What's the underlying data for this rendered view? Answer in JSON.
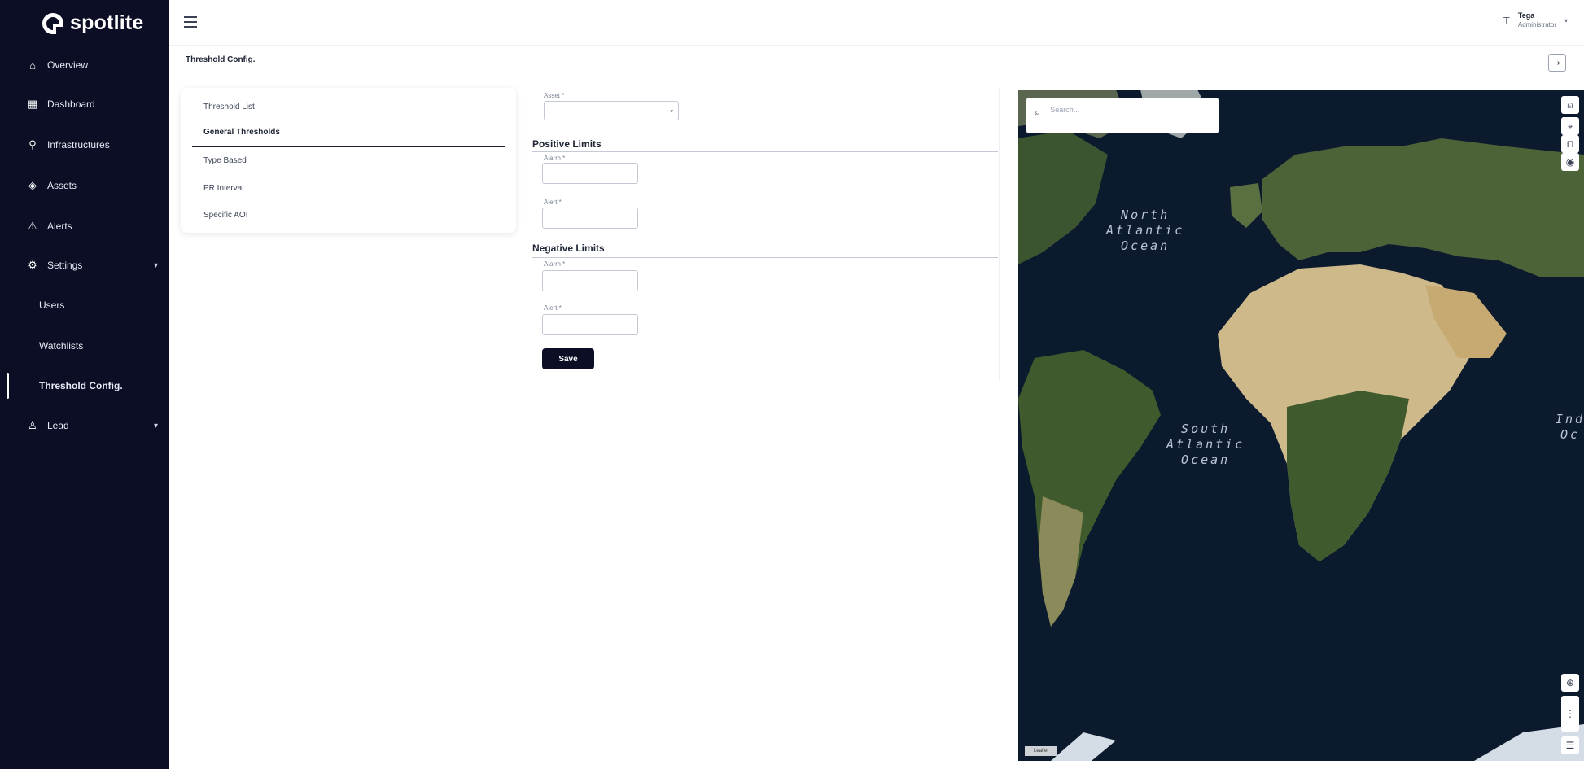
{
  "brand": {
    "name": "spotlite"
  },
  "sidebar": {
    "items": [
      {
        "label": "Overview",
        "icon": "home-icon"
      },
      {
        "label": "Dashboard",
        "icon": "grid-icon"
      },
      {
        "label": "Infrastructures",
        "icon": "network-icon"
      },
      {
        "label": "Assets",
        "icon": "shield-icon"
      },
      {
        "label": "Alerts",
        "icon": "warning-icon"
      },
      {
        "label": "Settings",
        "icon": "gear-icon"
      },
      {
        "label": "Users"
      },
      {
        "label": "Watchlists"
      },
      {
        "label": "Threshold Config."
      },
      {
        "label": "Lead",
        "icon": "user-icon"
      }
    ],
    "active": "Threshold Config."
  },
  "header": {
    "user_initial": "T",
    "user_name": "Tega",
    "user_role": "Administrator"
  },
  "page": {
    "title": "Threshold Config."
  },
  "threshold_nav": {
    "items": [
      "Threshold List",
      "General Thresholds",
      "Type Based",
      "PR Interval",
      "Specific AOI"
    ],
    "active": "General Thresholds"
  },
  "form": {
    "asset_label": "Asset *",
    "positive_title": "Positive Limits",
    "negative_title": "Negative Limits",
    "alarm_label": "Alarm *",
    "alert_label": "Alert *",
    "save_label": "Save"
  },
  "map": {
    "search_placeholder": "Search...",
    "ocean_north": [
      "North",
      "Atlantic",
      "Ocean"
    ],
    "ocean_south": [
      "South",
      "Atlantic",
      "Ocean"
    ],
    "ocean_indian": [
      "Ind",
      "Oc"
    ],
    "attribution": "Leaflet",
    "colors": {
      "ocean": "#0c1a2e",
      "land_green": "#3f5a2c",
      "desert": "#cdb98a"
    }
  }
}
